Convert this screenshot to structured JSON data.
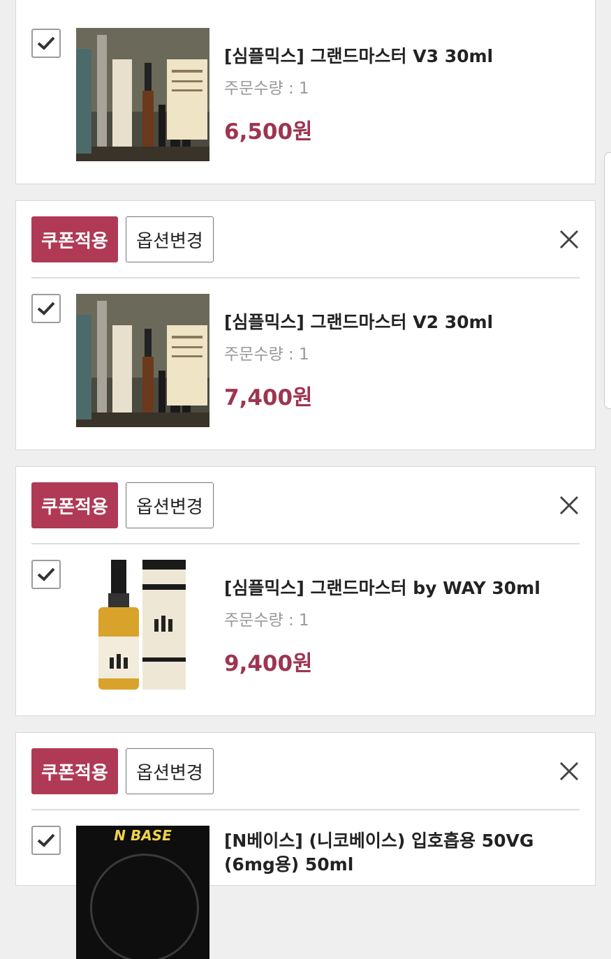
{
  "cart": {
    "coupon_label": "쿠폰적용",
    "option_label": "옵션변경",
    "items": [
      {
        "name": "[심플믹스] 그랜드마스터 V3 30ml",
        "qty": "주문수량 : 1",
        "price": "6,500원",
        "checked": true
      },
      {
        "name": "[심플믹스] 그랜드마스터 V2 30ml",
        "qty": "주문수량 : 1",
        "price": "7,400원",
        "checked": true
      },
      {
        "name": "[심플믹스] 그랜드마스터 by WAY 30ml",
        "qty": "주문수량 : 1",
        "price": "9,400원",
        "checked": true
      },
      {
        "name": "[N베이스] (니코베이스) 입호흡용 50VG (6mg용) 50ml",
        "qty": "",
        "price": "",
        "checked": true,
        "thumb_text": "N BASE"
      }
    ]
  },
  "colors": {
    "accent": "#b03a55",
    "price": "#9e3450",
    "background": "#efefef"
  },
  "icons": {
    "close": "close-icon",
    "check": "check-icon"
  }
}
